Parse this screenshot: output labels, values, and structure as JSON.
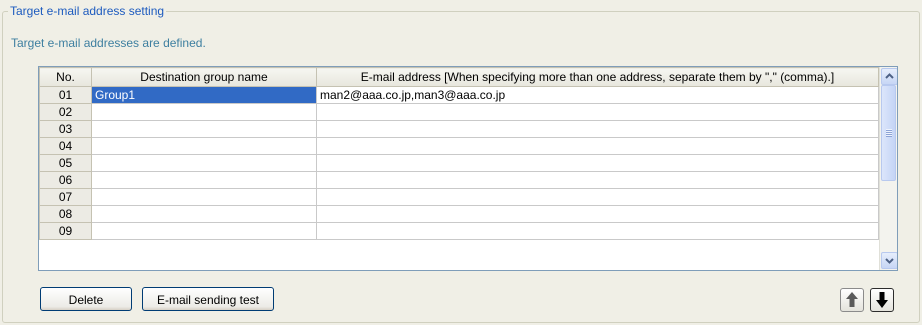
{
  "section": {
    "title": "Target e-mail address setting",
    "description": "Target e-mail addresses are defined."
  },
  "grid": {
    "columns": [
      "No.",
      "Destination group name",
      "E-mail address [When specifying more than one address, separate them by \",\" (comma).]"
    ],
    "rows": [
      {
        "no": "01",
        "group": "Group1",
        "email": "man2@aaa.co.jp,man3@aaa.co.jp"
      },
      {
        "no": "02",
        "group": "",
        "email": ""
      },
      {
        "no": "03",
        "group": "",
        "email": ""
      },
      {
        "no": "04",
        "group": "",
        "email": ""
      },
      {
        "no": "05",
        "group": "",
        "email": ""
      },
      {
        "no": "06",
        "group": "",
        "email": ""
      },
      {
        "no": "07",
        "group": "",
        "email": ""
      },
      {
        "no": "08",
        "group": "",
        "email": ""
      },
      {
        "no": "09",
        "group": "",
        "email": ""
      }
    ],
    "selected_row": 0,
    "selection_color": "#316ac5"
  },
  "buttons": {
    "delete": "Delete",
    "test": "E-mail sending test",
    "move_up_icon": "arrow-up-icon",
    "move_down_icon": "arrow-down-icon"
  },
  "scrollbar": {
    "up_icon": "chevron-up-icon",
    "down_icon": "chevron-down-icon"
  }
}
